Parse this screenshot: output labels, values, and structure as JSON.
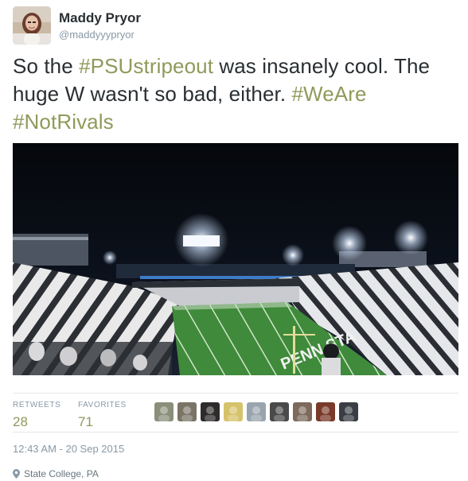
{
  "user": {
    "name": "Maddy Pryor",
    "handle": "@maddyyypryor",
    "avatar_icon": "profile-photo-icon"
  },
  "tweet": {
    "segments": [
      {
        "text": "So the ",
        "hashtag": false
      },
      {
        "text": "#PSUstripeout",
        "hashtag": true
      },
      {
        "text": " was insanely cool. The huge W wasn't so bad, either. ",
        "hashtag": false
      },
      {
        "text": "#WeAre",
        "hashtag": true
      },
      {
        "text": " ",
        "hashtag": false
      },
      {
        "text": "#NotRivals",
        "hashtag": true
      }
    ],
    "photo_icon": "stadium-photo-icon"
  },
  "stats": {
    "retweets_label": "RETWEETS",
    "retweets": "28",
    "favorites_label": "FAVORITES",
    "favorites": "71"
  },
  "favoriters": [
    {
      "icon": "favoriter-avatar-icon",
      "color": "#8a8f7a"
    },
    {
      "icon": "favoriter-avatar-icon",
      "color": "#7a7466"
    },
    {
      "icon": "favoriter-avatar-icon",
      "color": "#2e2b2b"
    },
    {
      "icon": "favoriter-avatar-icon",
      "color": "#d6c26a"
    },
    {
      "icon": "favoriter-avatar-icon",
      "color": "#9aa4ae"
    },
    {
      "icon": "favoriter-avatar-icon",
      "color": "#4a4a4a"
    },
    {
      "icon": "favoriter-avatar-icon",
      "color": "#7d6a5c"
    },
    {
      "icon": "favoriter-avatar-icon",
      "color": "#7a3a2a"
    },
    {
      "icon": "favoriter-avatar-icon",
      "color": "#3a3e44"
    }
  ],
  "timestamp": "12:43 AM - 20 Sep 2015",
  "location": {
    "icon": "location-pin-icon",
    "text": "State College, PA"
  },
  "colors": {
    "hashtag": "#8f9a5a",
    "stat_value": "#8f9a5a",
    "muted": "#8899a6"
  }
}
